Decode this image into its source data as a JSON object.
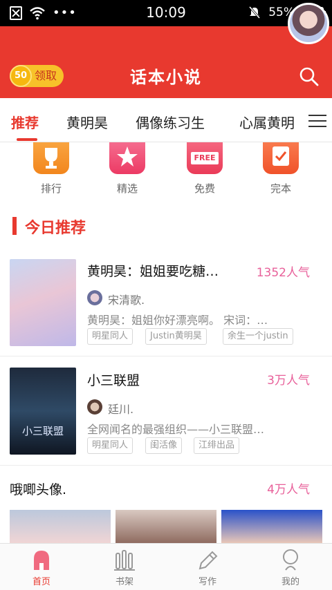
{
  "status_bar": {
    "time": "10:09",
    "battery": "55%",
    "battery_level": 0.55
  },
  "header": {
    "title": "话本小说",
    "coin_amount": "50",
    "coin_action": "领取"
  },
  "tabs": [
    {
      "label": "推荐",
      "active": true
    },
    {
      "label": "黄明昊",
      "active": false
    },
    {
      "label": "偶像练习生",
      "active": false
    },
    {
      "label": "心属黄明",
      "active": false
    }
  ],
  "categories": [
    {
      "label": "排行",
      "icon": "trophy-icon"
    },
    {
      "label": "精选",
      "icon": "star-icon"
    },
    {
      "label": "免费",
      "icon": "free-icon",
      "badge": "FREE"
    },
    {
      "label": "完本",
      "icon": "check-icon"
    }
  ],
  "section": {
    "title": "今日推荐"
  },
  "books": [
    {
      "title": "黄明昊：姐姐要吃糖…",
      "popularity": "1352人气",
      "author": "宋清歌.",
      "description": "黄明昊：姐姐你好漂亮啊。 宋词：…",
      "tags": [
        "明星同人",
        "Justin黄明昊",
        "余生一个justin"
      ]
    },
    {
      "title": "小三联盟",
      "popularity": "3万人气",
      "author": "廷川.",
      "description": "全网闻名的最强组织——小三联盟…",
      "tags": [
        "明星同人",
        "闺活像",
        "江绯出品"
      ],
      "cover_text": "小三联盟"
    }
  ],
  "row3": {
    "title": "哦唧头像.",
    "popularity": "4万人气"
  },
  "bottom_nav": [
    {
      "label": "首页",
      "active": true,
      "icon": "home-icon"
    },
    {
      "label": "书架",
      "active": false,
      "icon": "bookshelf-icon"
    },
    {
      "label": "写作",
      "active": false,
      "icon": "pen-icon"
    },
    {
      "label": "我的",
      "active": false,
      "icon": "profile-icon"
    }
  ],
  "colors": {
    "brand": "#e8392f",
    "popularity": "#e8609a",
    "coin": "#f7c22a"
  }
}
